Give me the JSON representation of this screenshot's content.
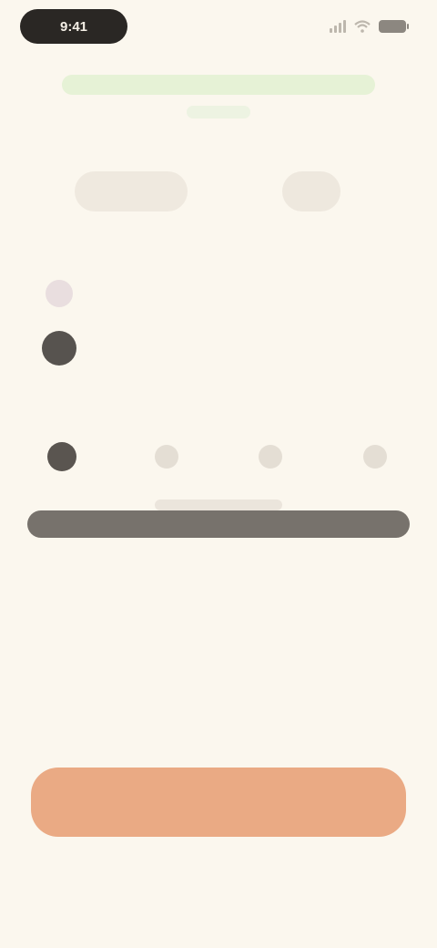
{
  "status_bar": {
    "time": "9:41",
    "icons": [
      "signal-icon",
      "wifi-icon",
      "battery-icon"
    ]
  },
  "notice": {
    "text": "",
    "subtext": ""
  },
  "tabs": [
    {
      "label": "",
      "active": true
    },
    {
      "label": "",
      "active": false
    }
  ],
  "section": {
    "title": "",
    "rows": [
      {
        "label": "",
        "value": "",
        "icon": "app-icon"
      },
      {
        "label": "",
        "value": "",
        "icon": "avatar-icon"
      }
    ]
  },
  "nav": {
    "items": [
      {
        "label": "",
        "icon": "home-icon",
        "active": true
      },
      {
        "label": "",
        "icon": "list-icon",
        "active": false
      },
      {
        "label": "",
        "icon": "bell-icon",
        "active": false
      },
      {
        "label": "",
        "icon": "profile-icon",
        "active": false
      }
    ]
  },
  "main": {
    "headline": ""
  },
  "cta": {
    "label": ""
  },
  "footer": {
    "link": ""
  },
  "colors": {
    "background": "#fbf7ee",
    "accent": "#eaaa84",
    "notice": "#e6f2d6",
    "dark": "#2a2724"
  }
}
